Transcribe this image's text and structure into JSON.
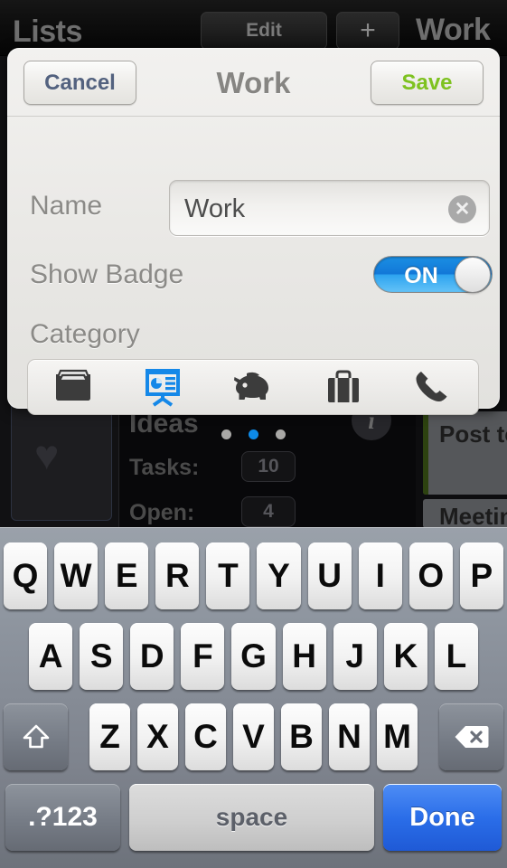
{
  "background": {
    "nav": {
      "left_title": "Lists",
      "edit_label": "Edit",
      "add_label": "+",
      "right_title": "Work"
    },
    "detail": {
      "list_name": "Ideas",
      "info_icon": "i",
      "tasks_label": "Tasks:",
      "tasks_value": "10",
      "open_label": "Open:",
      "open_value": "4",
      "favorite_icon": "♥"
    },
    "right_cards": [
      {
        "title": "Post to"
      },
      {
        "title": "Meetin"
      }
    ]
  },
  "modal": {
    "title": "Work",
    "cancel_label": "Cancel",
    "save_label": "Save",
    "cancel_color": "#53627f",
    "save_color": "#7ec220",
    "fields": {
      "name_label": "Name",
      "name_value": "Work",
      "name_placeholder": "Name",
      "clear_icon": "✕",
      "badge_label": "Show Badge",
      "badge_state": "ON",
      "badge_on_color": "#1278d8",
      "category_label": "Category"
    },
    "categories": [
      {
        "name": "file-tray-icon",
        "selected": false
      },
      {
        "name": "presentation-icon",
        "selected": true
      },
      {
        "name": "piggy-bank-icon",
        "selected": false
      },
      {
        "name": "briefcase-icon",
        "selected": false
      },
      {
        "name": "phone-icon",
        "selected": false
      }
    ],
    "selected_color": "#1588e8",
    "page_dots": {
      "count": 3,
      "active_index": 1
    }
  },
  "keyboard": {
    "row1": [
      "Q",
      "W",
      "E",
      "R",
      "T",
      "Y",
      "U",
      "I",
      "O",
      "P"
    ],
    "row2": [
      "A",
      "S",
      "D",
      "F",
      "G",
      "H",
      "J",
      "K",
      "L"
    ],
    "row3": [
      "Z",
      "X",
      "C",
      "V",
      "B",
      "N",
      "M"
    ],
    "shift_icon": "⇧",
    "backspace_icon": "⌫",
    "numeric_label": ".?123",
    "space_label": "space",
    "done_label": "Done"
  }
}
